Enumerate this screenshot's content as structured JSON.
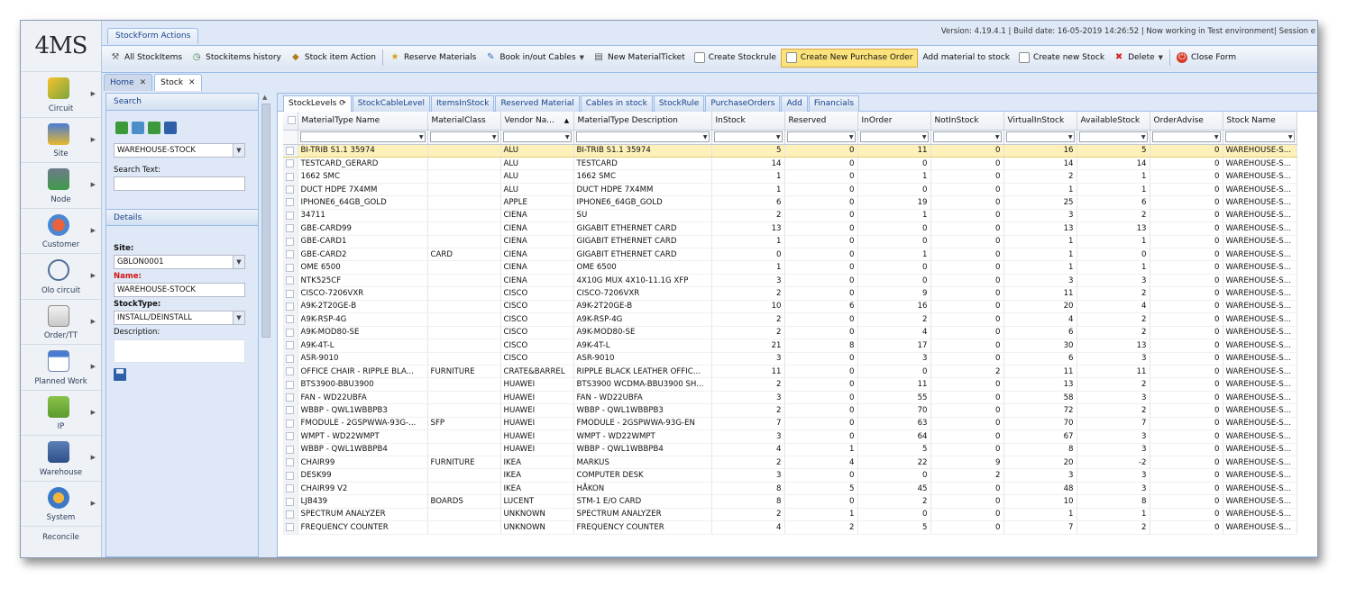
{
  "logo": "4MS",
  "version_text": "Version: 4.19.4.1 | Build date: 16-05-2019 14:26:52 | Now working in Test environment| Session e",
  "actions_tab": "StockForm Actions",
  "toolbar": {
    "all_stockitems": "All StockItems",
    "stockitems_history": "Stockitems history",
    "stock_item_action": "Stock item Action",
    "reserve_materials": "Reserve Materials",
    "book_cables": "Book in/out Cables",
    "new_material_ticket": "New MaterialTicket",
    "create_stockrule": "Create Stockrule",
    "create_purchase_order": "Create New Purchase Order",
    "add_material_to_stock": "Add material to stock",
    "create_new_stock": "Create new Stock",
    "delete": "Delete",
    "close_form": "Close Form"
  },
  "page_tabs": [
    "Home",
    "Stock"
  ],
  "rail": [
    "Circuit",
    "Site",
    "Node",
    "Customer",
    "Olo circuit",
    "Order/TT",
    "Planned Work",
    "IP",
    "Warehouse",
    "System",
    "Reconcile"
  ],
  "search": {
    "header": "Search",
    "warehouse": "WAREHOUSE-STOCK",
    "search_text_label": "Search Text:",
    "search_text_value": ""
  },
  "details": {
    "header": "Details",
    "site_label": "Site:",
    "site_value": "GBLON0001",
    "name_label": "Name:",
    "name_value": "WAREHOUSE-STOCK",
    "stocktype_label": "StockType:",
    "stocktype_value": "INSTALL/DEINSTALL",
    "description_label": "Description:"
  },
  "grid_tabs": [
    "StockLevels",
    "StockCableLevel",
    "ItemsInStock",
    "Reserved Material",
    "Cables in stock",
    "StockRule",
    "PurchaseOrders",
    "Add",
    "Financials"
  ],
  "columns": [
    "MaterialType Name",
    "MaterialClass",
    "Vendor Na...",
    "MaterialType Description",
    "InStock",
    "Reserved",
    "InOrder",
    "NotInStock",
    "VirtualInStock",
    "AvailableStock",
    "OrderAdvise",
    "Stock Name"
  ],
  "rows": [
    [
      "BI-TRIB S1.1 35974",
      "",
      "ALU",
      "BI-TRIB S1.1 35974",
      "5",
      "0",
      "11",
      "0",
      "16",
      "5",
      "0",
      "WAREHOUSE-S..."
    ],
    [
      "TESTCARD_GERARD",
      "",
      "ALU",
      "TESTCARD",
      "14",
      "0",
      "0",
      "0",
      "14",
      "14",
      "0",
      "WAREHOUSE-S..."
    ],
    [
      "1662 SMC",
      "",
      "ALU",
      "1662 SMC",
      "1",
      "0",
      "1",
      "0",
      "2",
      "1",
      "0",
      "WAREHOUSE-S..."
    ],
    [
      "DUCT HDPE 7X4MM",
      "",
      "ALU",
      "DUCT HDPE 7X4MM",
      "1",
      "0",
      "0",
      "0",
      "1",
      "1",
      "0",
      "WAREHOUSE-S..."
    ],
    [
      "IPHONE6_64GB_GOLD",
      "",
      "APPLE",
      "IPHONE6_64GB_GOLD",
      "6",
      "0",
      "19",
      "0",
      "25",
      "6",
      "0",
      "WAREHOUSE-S..."
    ],
    [
      "34711",
      "",
      "CIENA",
      "SU",
      "2",
      "0",
      "1",
      "0",
      "3",
      "2",
      "0",
      "WAREHOUSE-S..."
    ],
    [
      "GBE-CARD99",
      "",
      "CIENA",
      "GIGABIT ETHERNET CARD",
      "13",
      "0",
      "0",
      "0",
      "13",
      "13",
      "0",
      "WAREHOUSE-S..."
    ],
    [
      "GBE-CARD1",
      "",
      "CIENA",
      "GIGABIT ETHERNET CARD",
      "1",
      "0",
      "0",
      "0",
      "1",
      "1",
      "0",
      "WAREHOUSE-S..."
    ],
    [
      "GBE-CARD2",
      "CARD",
      "CIENA",
      "GIGABIT ETHERNET CARD",
      "0",
      "0",
      "1",
      "0",
      "1",
      "0",
      "0",
      "WAREHOUSE-S..."
    ],
    [
      "OME 6500",
      "",
      "CIENA",
      "OME 6500",
      "1",
      "0",
      "0",
      "0",
      "1",
      "1",
      "0",
      "WAREHOUSE-S..."
    ],
    [
      "NTK525CF",
      "",
      "CIENA",
      "4X10G MUX 4X10-11.1G XFP",
      "3",
      "0",
      "0",
      "0",
      "3",
      "3",
      "0",
      "WAREHOUSE-S..."
    ],
    [
      "CISCO-7206VXR",
      "",
      "CISCO",
      "CISCO-7206VXR",
      "2",
      "0",
      "9",
      "0",
      "11",
      "2",
      "0",
      "WAREHOUSE-S..."
    ],
    [
      "A9K-2T20GE-B",
      "",
      "CISCO",
      "A9K-2T20GE-B",
      "10",
      "6",
      "16",
      "0",
      "20",
      "4",
      "0",
      "WAREHOUSE-S..."
    ],
    [
      "A9K-RSP-4G",
      "",
      "CISCO",
      "A9K-RSP-4G",
      "2",
      "0",
      "2",
      "0",
      "4",
      "2",
      "0",
      "WAREHOUSE-S..."
    ],
    [
      "A9K-MOD80-SE",
      "",
      "CISCO",
      "A9K-MOD80-SE",
      "2",
      "0",
      "4",
      "0",
      "6",
      "2",
      "0",
      "WAREHOUSE-S..."
    ],
    [
      "A9K-4T-L",
      "",
      "CISCO",
      "A9K-4T-L",
      "21",
      "8",
      "17",
      "0",
      "30",
      "13",
      "0",
      "WAREHOUSE-S..."
    ],
    [
      "ASR-9010",
      "",
      "CISCO",
      "ASR-9010",
      "3",
      "0",
      "3",
      "0",
      "6",
      "3",
      "0",
      "WAREHOUSE-S..."
    ],
    [
      "OFFICE CHAIR - RIPPLE BLA...",
      "FURNITURE",
      "CRATE&BARREL",
      "RIPPLE BLACK LEATHER OFFIC...",
      "11",
      "0",
      "0",
      "2",
      "11",
      "11",
      "0",
      "WAREHOUSE-S..."
    ],
    [
      "BTS3900-BBU3900",
      "",
      "HUAWEI",
      "BTS3900 WCDMA-BBU3900 SH...",
      "2",
      "0",
      "11",
      "0",
      "13",
      "2",
      "0",
      "WAREHOUSE-S..."
    ],
    [
      "FAN - WD22UBFA",
      "",
      "HUAWEI",
      "FAN - WD22UBFA",
      "3",
      "0",
      "55",
      "0",
      "58",
      "3",
      "0",
      "WAREHOUSE-S..."
    ],
    [
      "WBBP - QWL1WBBPB3",
      "",
      "HUAWEI",
      "WBBP - QWL1WBBPB3",
      "2",
      "0",
      "70",
      "0",
      "72",
      "2",
      "0",
      "WAREHOUSE-S..."
    ],
    [
      "FMODULE - 2GSPWWA-93G-...",
      "SFP",
      "HUAWEI",
      "FMODULE - 2GSPWWA-93G-EN",
      "7",
      "0",
      "63",
      "0",
      "70",
      "7",
      "0",
      "WAREHOUSE-S..."
    ],
    [
      "WMPT - WD22WMPT",
      "",
      "HUAWEI",
      "WMPT - WD22WMPT",
      "3",
      "0",
      "64",
      "0",
      "67",
      "3",
      "0",
      "WAREHOUSE-S..."
    ],
    [
      "WBBP - QWL1WBBPB4",
      "",
      "HUAWEI",
      "WBBP - QWL1WBBPB4",
      "4",
      "1",
      "5",
      "0",
      "8",
      "3",
      "0",
      "WAREHOUSE-S..."
    ],
    [
      "CHAIR99",
      "FURNITURE",
      "IKEA",
      "MARKUS",
      "2",
      "4",
      "22",
      "9",
      "20",
      "-2",
      "0",
      "WAREHOUSE-S..."
    ],
    [
      "DESK99",
      "",
      "IKEA",
      "COMPUTER DESK",
      "3",
      "0",
      "0",
      "2",
      "3",
      "3",
      "0",
      "WAREHOUSE-S..."
    ],
    [
      "CHAIR99 V2",
      "",
      "IKEA",
      "HÅKON",
      "8",
      "5",
      "45",
      "0",
      "48",
      "3",
      "0",
      "WAREHOUSE-S..."
    ],
    [
      "LJB439",
      "BOARDS",
      "LUCENT",
      "STM-1 E/O CARD",
      "8",
      "0",
      "2",
      "0",
      "10",
      "8",
      "0",
      "WAREHOUSE-S..."
    ],
    [
      "SPECTRUM ANALYZER",
      "",
      "UNKNOWN",
      "SPECTRUM ANALYZER",
      "2",
      "1",
      "0",
      "0",
      "1",
      "1",
      "0",
      "WAREHOUSE-S..."
    ],
    [
      "FREQUENCY COUNTER",
      "",
      "UNKNOWN",
      "FREQUENCY COUNTER",
      "4",
      "2",
      "5",
      "0",
      "7",
      "2",
      "0",
      "WAREHOUSE-S..."
    ]
  ],
  "colors": {
    "accent": "#15428b",
    "selected_row": "#fdf0b8",
    "highlight_button": "#fbe27a",
    "name_label": "#d21414"
  }
}
